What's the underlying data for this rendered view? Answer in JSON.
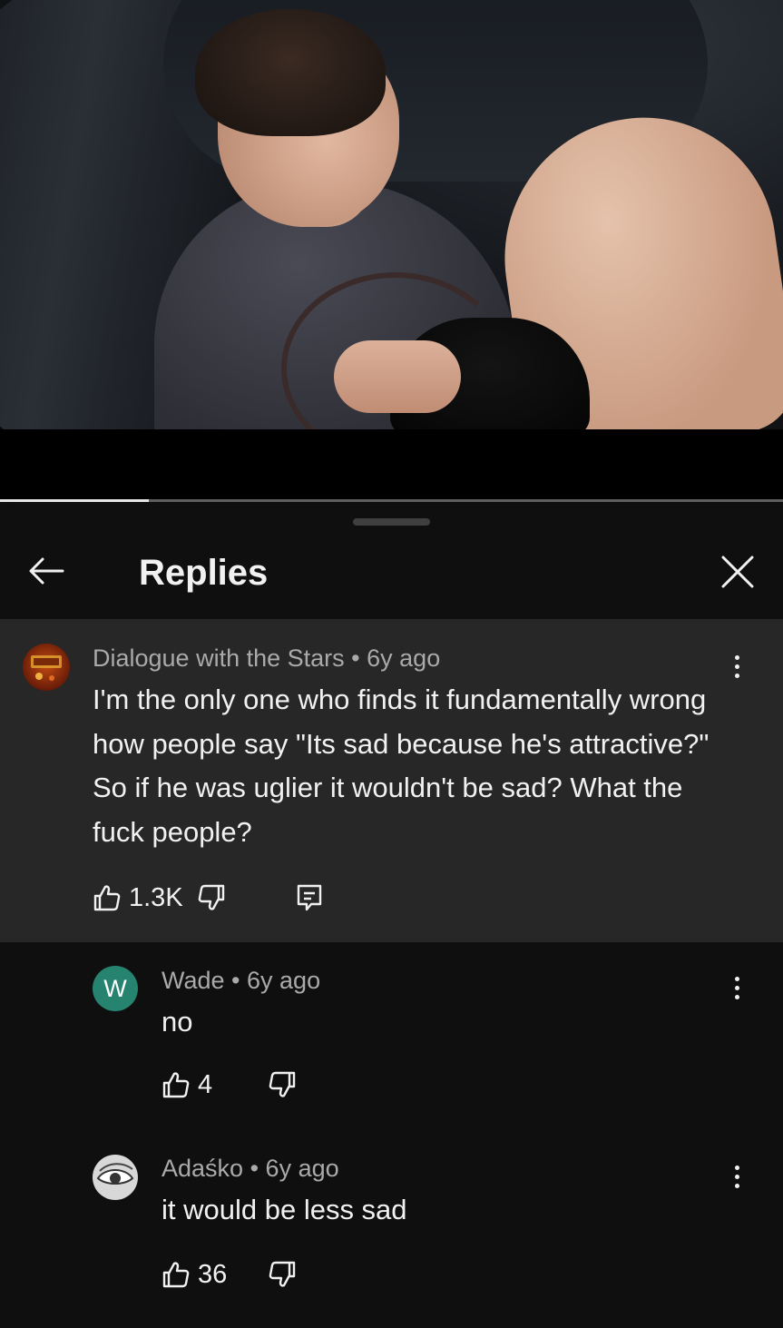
{
  "video": {
    "progress": 0.19
  },
  "panel": {
    "title": "Replies"
  },
  "parent_comment": {
    "author": "Dialogue with the Stars",
    "separator": "•",
    "age": "6y ago",
    "text": "I'm the only one who finds it fundamentally wrong how people say \"Its sad because he's attractive?\" So if he was uglier it wouldn't be sad? What the fuck people?",
    "likes": "1.3K"
  },
  "replies": [
    {
      "avatar_letter": "W",
      "avatar_color": "#26836f",
      "author": "Wade",
      "separator": "•",
      "age": "6y ago",
      "text": "no",
      "likes": "4"
    },
    {
      "author": "Adaśko",
      "separator": "•",
      "age": "6y ago",
      "text": "it would be less sad",
      "likes": "36"
    }
  ],
  "colors": {
    "background": "#0f0f0f",
    "highlight": "#272727",
    "primary_text": "#f1f1f1",
    "secondary_text": "#aaaaaa"
  }
}
